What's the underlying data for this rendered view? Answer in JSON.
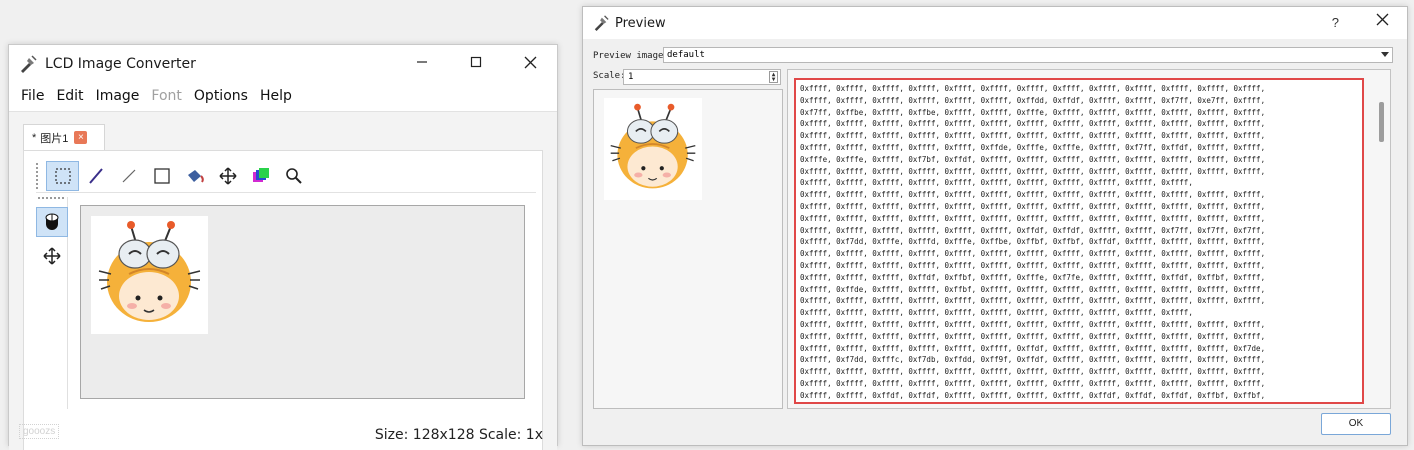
{
  "left_window": {
    "title": "LCD Image Converter",
    "menu": [
      "File",
      "Edit",
      "Image",
      "Font",
      "Options",
      "Help"
    ],
    "tab": {
      "modified_marker": "*",
      "label": "图片1",
      "close": "×"
    },
    "toolbar_icons": [
      "select-rect-icon",
      "draw-line-icon",
      "straight-line-icon",
      "rectangle-icon",
      "fill-bucket-icon",
      "move-icon",
      "color-icon",
      "zoom-icon"
    ],
    "side_icons": [
      "mouse-icon",
      "move-icon"
    ],
    "status": "Size: 128x128 Scale: 1x",
    "watermark": "gooozs"
  },
  "right_window": {
    "title": "Preview",
    "help": "?",
    "preview_label": "Preview image:",
    "preview_value": "default",
    "scale_label": "Scale:",
    "scale_value": "1",
    "ok_label": "OK",
    "code_lines": [
      "0xffff, 0xffff, 0xffff, 0xffff, 0xffff, 0xffff, 0xffff, 0xffff, 0xffff, 0xffff, 0xffff, 0xffff, 0xffff,",
      "0xffff, 0xffff, 0xffff, 0xffff, 0xffff, 0xffff, 0xffdd, 0xffdf, 0xffff, 0xffff, 0xf7ff, 0xe7ff, 0xffff,",
      "0xf7ff, 0xffbe, 0xffff, 0xffbe, 0xffff, 0xffff, 0xfffe, 0xffff, 0xffff, 0xffff, 0xffff, 0xffff, 0xffff,",
      "0xffff, 0xffff, 0xffff, 0xffff, 0xffff, 0xffff, 0xffff, 0xffff, 0xffff, 0xffff, 0xffff, 0xffff, 0xffff,",
      "0xffff, 0xffff, 0xffff, 0xffff, 0xffff, 0xffff, 0xffff, 0xffff, 0xffff, 0xffff, 0xffff, 0xffff, 0xffff,",
      "0xffff, 0xffff, 0xffff, 0xffff, 0xffff, 0xffde, 0xfffe, 0xfffe, 0xffff, 0xf7ff, 0xffdf, 0xffff, 0xffff,",
      "0xfffe, 0xfffe, 0xffff, 0xf7bf, 0xffdf, 0xffff, 0xffff, 0xffff, 0xffff, 0xffff, 0xffff, 0xffff, 0xffff,",
      "0xffff, 0xffff, 0xffff, 0xffff, 0xffff, 0xffff, 0xffff, 0xffff, 0xffff, 0xffff, 0xffff, 0xffff, 0xffff,",
      "0xffff, 0xffff, 0xffff, 0xffff, 0xffff, 0xffff, 0xffff, 0xffff, 0xffff, 0xffff, 0xffff,",
      "0xffff, 0xffff, 0xffff, 0xffff, 0xffff, 0xffff, 0xffff, 0xffff, 0xffff, 0xffff, 0xffff, 0xffff, 0xffff,",
      "0xffff, 0xffff, 0xffff, 0xffff, 0xffff, 0xffff, 0xffff, 0xffff, 0xffff, 0xffff, 0xffff, 0xffff, 0xffff,",
      "0xffff, 0xffff, 0xffff, 0xffff, 0xffff, 0xffff, 0xffff, 0xffff, 0xffff, 0xffff, 0xffff, 0xffff, 0xffff,",
      "0xffff, 0xffff, 0xffff, 0xffff, 0xffff, 0xffff, 0xffdf, 0xffdf, 0xffff, 0xffff, 0xf7ff, 0xf7ff, 0xf7ff,",
      "0xffff, 0xf7dd, 0xfffe, 0xfffd, 0xfffe, 0xffbe, 0xffbf, 0xffbf, 0xffdf, 0xffff, 0xffff, 0xffff, 0xffff,",
      "0xffff, 0xffff, 0xffff, 0xffff, 0xffff, 0xffff, 0xffff, 0xffff, 0xffff, 0xffff, 0xffff, 0xffff, 0xffff,",
      "0xffff, 0xffff, 0xffff, 0xffff, 0xffff, 0xffff, 0xffff, 0xffff, 0xffff, 0xffff, 0xffff, 0xffff, 0xffff,",
      "0xffff, 0xffff, 0xffff, 0xffdf, 0xffbf, 0xffff, 0xfffe, 0xf7fe, 0xffff, 0xffff, 0xffdf, 0xffbf, 0xffff,",
      "0xffff, 0xffde, 0xffff, 0xffff, 0xffbf, 0xffff, 0xffff, 0xffff, 0xffff, 0xffff, 0xffff, 0xffff, 0xffff,",
      "0xffff, 0xffff, 0xffff, 0xffff, 0xffff, 0xffff, 0xffff, 0xffff, 0xffff, 0xffff, 0xffff, 0xffff, 0xffff,",
      "0xffff, 0xffff, 0xffff, 0xffff, 0xffff, 0xffff, 0xffff, 0xffff, 0xffff, 0xffff, 0xffff,",
      "0xffff, 0xffff, 0xffff, 0xffff, 0xffff, 0xffff, 0xffff, 0xffff, 0xffff, 0xffff, 0xffff, 0xffff, 0xffff,",
      "0xffff, 0xffff, 0xffff, 0xffff, 0xffff, 0xffff, 0xffff, 0xffff, 0xffff, 0xffff, 0xffff, 0xffff, 0xffff,",
      "0xffff, 0xffff, 0xffff, 0xffff, 0xffff, 0xffff, 0xffdf, 0xffff, 0xffff, 0xffff, 0xffff, 0xffff, 0xf7de,",
      "0xffff, 0xf7dd, 0xfffc, 0xf7db, 0xffdd, 0xff9f, 0xffdf, 0xffff, 0xffff, 0xffff, 0xffff, 0xffff, 0xffff,",
      "0xffff, 0xffff, 0xffff, 0xffff, 0xffff, 0xffff, 0xffff, 0xffff, 0xffff, 0xffff, 0xffff, 0xffff, 0xffff,",
      "0xffff, 0xffff, 0xffff, 0xffff, 0xffff, 0xffff, 0xffff, 0xffff, 0xffff, 0xffff, 0xffff, 0xffff, 0xffff,",
      "0xffff, 0xffff, 0xffdf, 0xffdf, 0xffff, 0xffff, 0xffff, 0xffff, 0xffdf, 0xffdf, 0xffdf, 0xffbf, 0xffbf,"
    ]
  },
  "colors": {
    "accent": "#e04848",
    "selected_tool": "#cfe3f7"
  }
}
